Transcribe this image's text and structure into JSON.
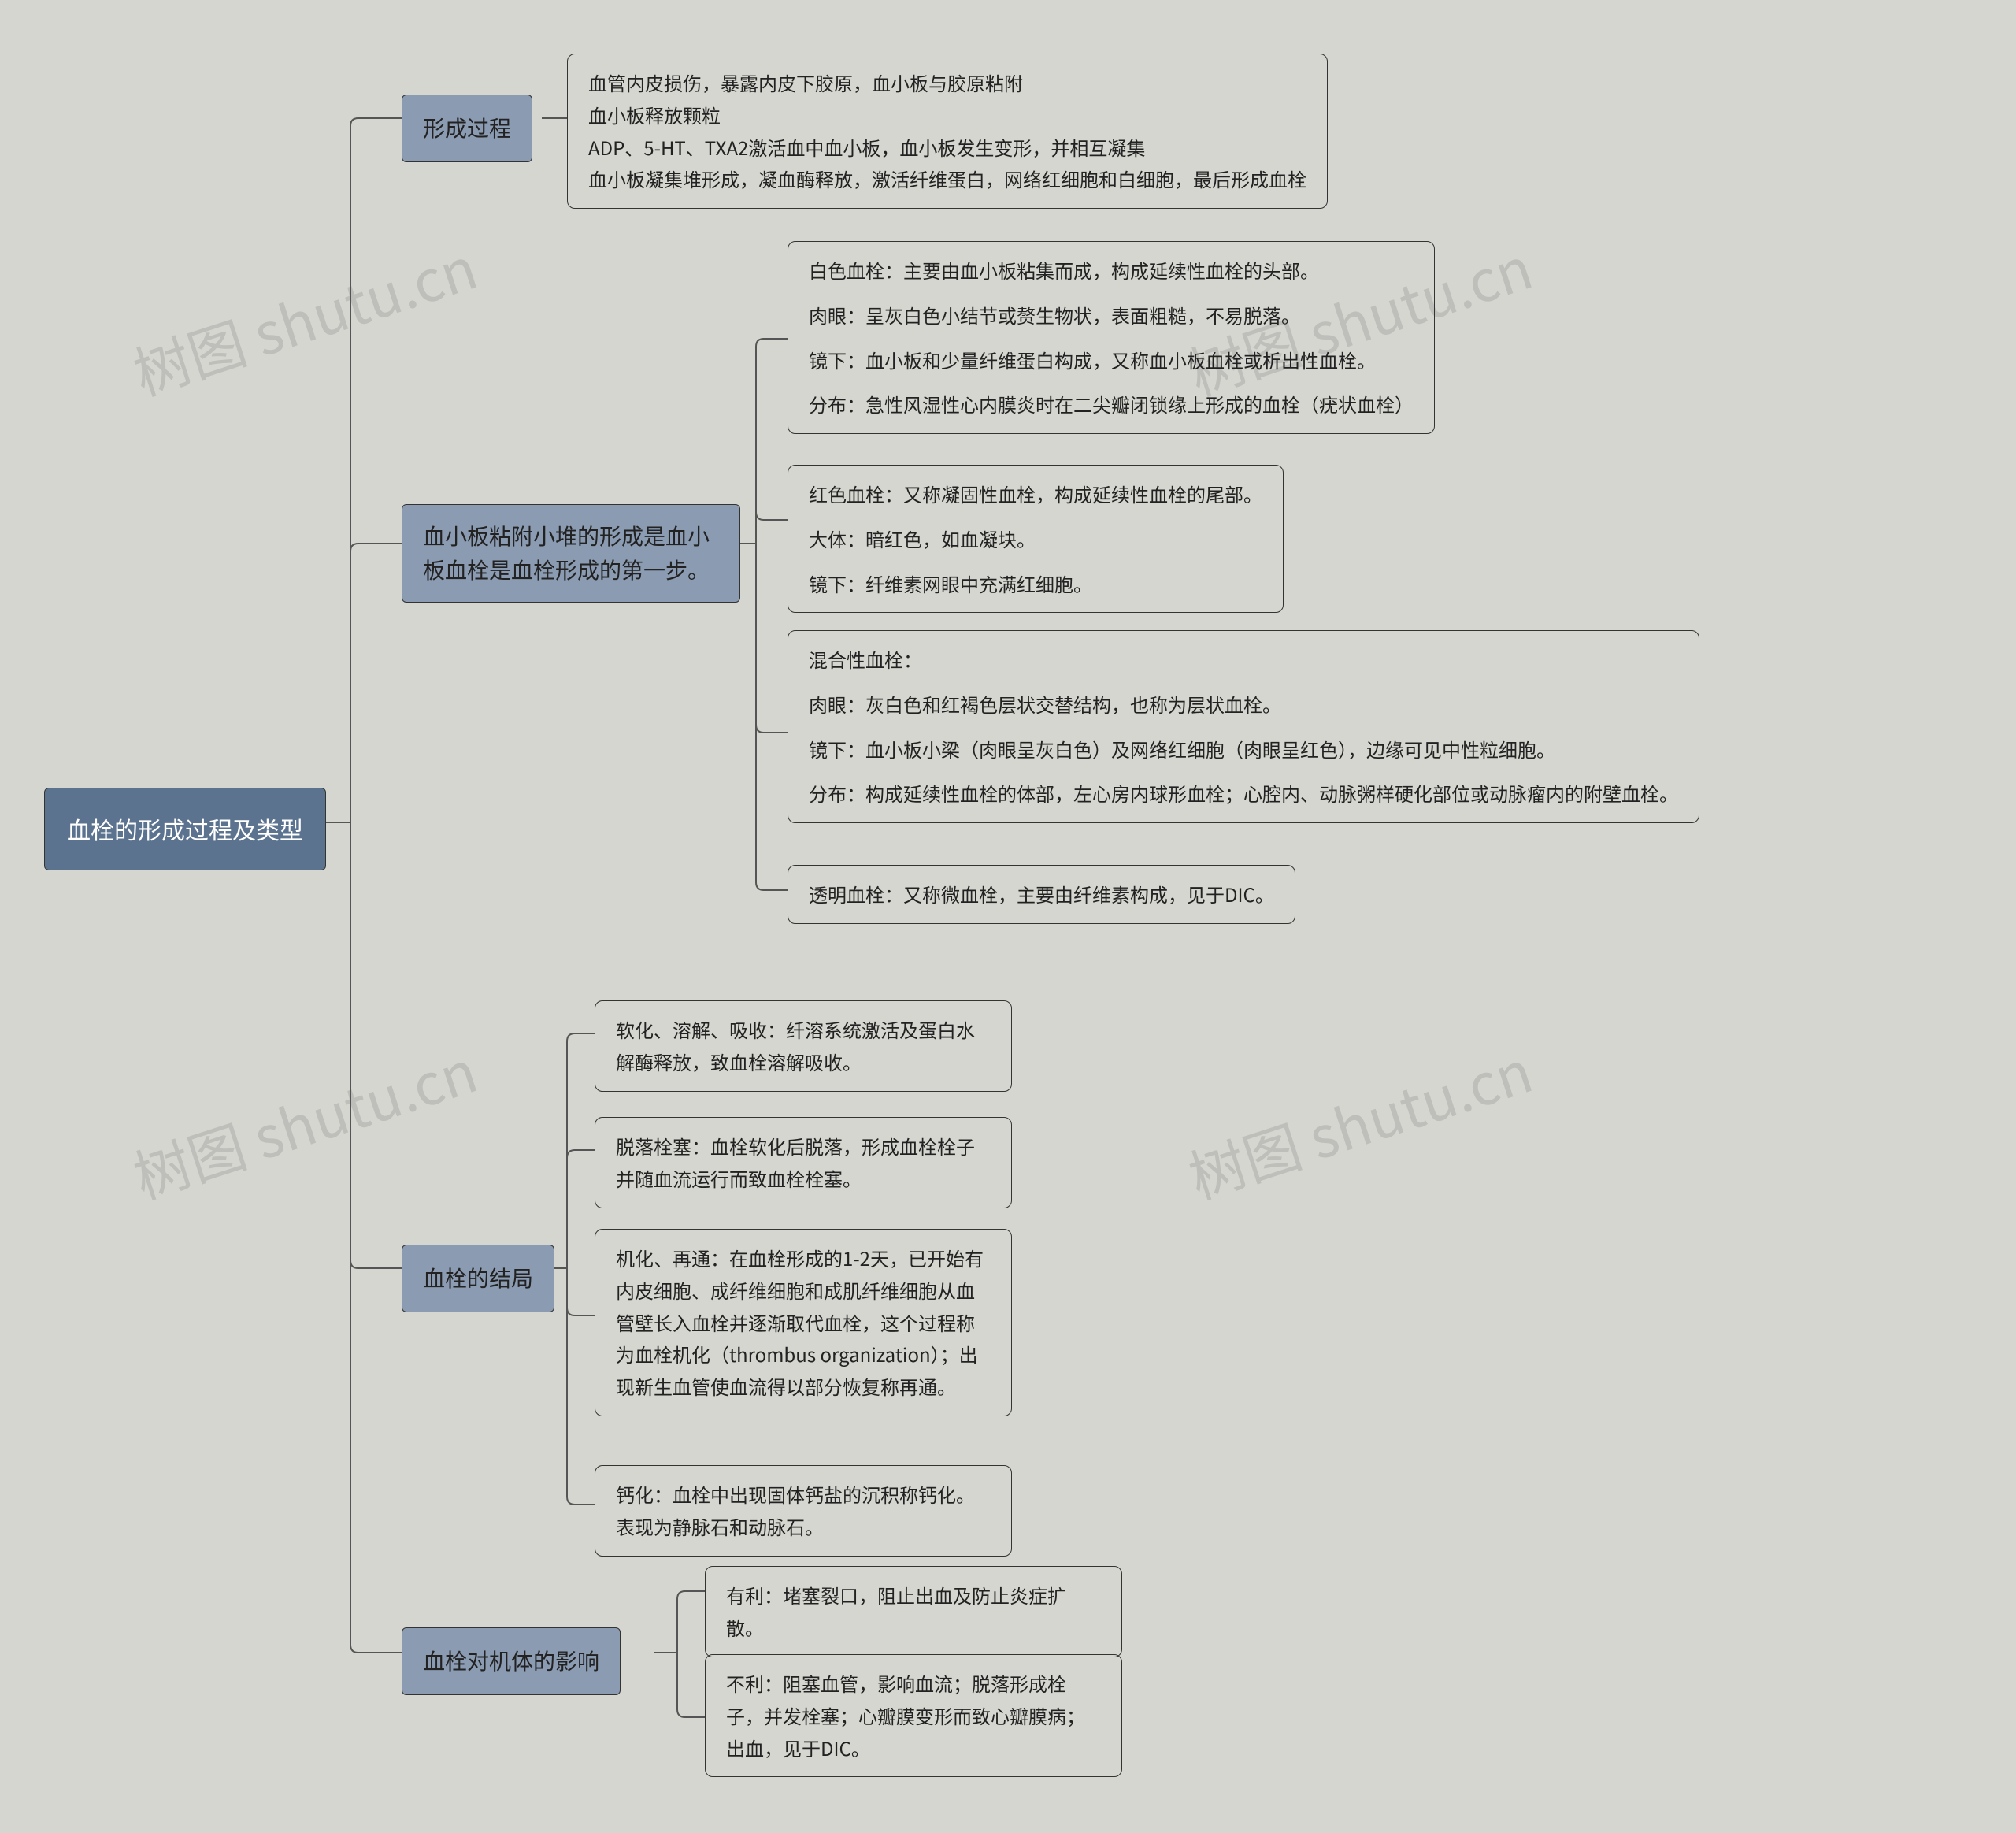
{
  "watermark": "树图 shutu.cn",
  "root": {
    "title": "血栓的形成过程及类型"
  },
  "branches": {
    "formation": {
      "label": "形成过程",
      "detail": {
        "line1": "血管内皮损伤，暴露内皮下胶原，血小板与胶原粘附",
        "line2": "血小板释放颗粒",
        "line3": "ADP、5-HT、TXA2激活血中血小板，血小板发生变形，并相互凝集",
        "line4": "血小板凝集堆形成，凝血酶释放，激活纤维蛋白，网络红细胞和白细胞，最后形成血栓"
      }
    },
    "types": {
      "label": "血小板粘附小堆的形成是血小板血栓是血栓形成的第一步。",
      "white": {
        "line1": "白色血栓：主要由血小板粘集而成，构成延续性血栓的头部。",
        "line2": "肉眼：呈灰白色小结节或赘生物状，表面粗糙，不易脱落。",
        "line3": "镜下：血小板和少量纤维蛋白构成，又称血小板血栓或析出性血栓。",
        "line4": "分布：急性风湿性心内膜炎时在二尖瓣闭锁缘上形成的血栓（疣状血栓）"
      },
      "red": {
        "line1": "红色血栓：又称凝固性血栓，构成延续性血栓的尾部。",
        "line2": "大体：暗红色，如血凝块。",
        "line3": "镜下：纤维素网眼中充满红细胞。"
      },
      "mixed": {
        "line1": "混合性血栓：",
        "line2": "肉眼：灰白色和红褐色层状交替结构，也称为层状血栓。",
        "line3": "镜下：血小板小梁（肉眼呈灰白色）及网络红细胞（肉眼呈红色），边缘可见中性粒细胞。",
        "line4": "分布：构成延续性血栓的体部，左心房内球形血栓；心腔内、动脉粥样硬化部位或动脉瘤内的附壁血栓。"
      },
      "transparent": {
        "line1": "透明血栓：又称微血栓，主要由纤维素构成，见于DIC。"
      }
    },
    "outcome": {
      "label": "血栓的结局",
      "dissolve": "软化、溶解、吸收：纤溶系统激活及蛋白水解酶释放，致血栓溶解吸收。",
      "detach": "脱落栓塞：血栓软化后脱落，形成血栓栓子并随血流运行而致血栓栓塞。",
      "organize": "机化、再通：在血栓形成的1-2天，已开始有内皮细胞、成纤维细胞和成肌纤维细胞从血管壁长入血栓并逐渐取代血栓，这个过程称为血栓机化（thrombus organization）；出现新生血管使血流得以部分恢复称再通。",
      "calcify": "钙化：血栓中出现固体钙盐的沉积称钙化。表现为静脉石和动脉石。"
    },
    "effect": {
      "label": "血栓对机体的影响",
      "good": "有利：堵塞裂口，阻止出血及防止炎症扩散。",
      "bad": "不利：阻塞血管，影响血流；脱落形成栓子，并发栓塞；心瓣膜变形而致心瓣膜病；出血，见于DIC。"
    }
  }
}
